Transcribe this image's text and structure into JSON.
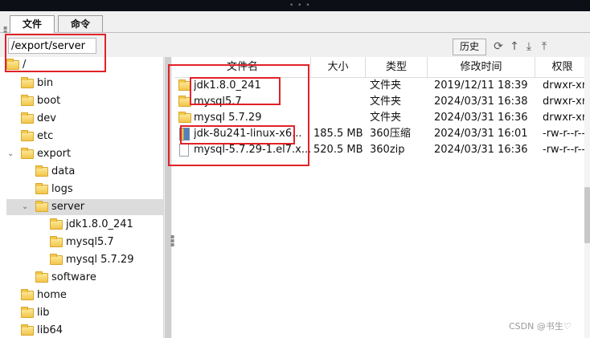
{
  "tabs": [
    {
      "label": "文件"
    },
    {
      "label": "命令"
    }
  ],
  "path": {
    "value": "/export/server"
  },
  "toolbar": {
    "history_label": "历史"
  },
  "tree": [
    {
      "label": "/"
    },
    {
      "label": "bin"
    },
    {
      "label": "boot"
    },
    {
      "label": "dev"
    },
    {
      "label": "etc"
    },
    {
      "label": "export"
    },
    {
      "label": "data"
    },
    {
      "label": "logs"
    },
    {
      "label": "server"
    },
    {
      "label": "jdk1.8.0_241"
    },
    {
      "label": "mysql5.7"
    },
    {
      "label": "mysql 5.7.29"
    },
    {
      "label": "software"
    },
    {
      "label": "home"
    },
    {
      "label": "lib"
    },
    {
      "label": "lib64"
    }
  ],
  "columns": [
    "文件名",
    "大小",
    "类型",
    "修改时间",
    "权限"
  ],
  "files": [
    {
      "name": "jdk1.8.0_241",
      "size": "",
      "type": "文件夹",
      "modified": "2019/12/11 18:39",
      "perm": "drwxr-xr-x",
      "icon": "folder-icon"
    },
    {
      "name": "mysql5.7",
      "size": "",
      "type": "文件夹",
      "modified": "2024/03/31 16:38",
      "perm": "drwxr-xr-x",
      "icon": "folder-icon"
    },
    {
      "name": "mysql 5.7.29",
      "size": "",
      "type": "文件夹",
      "modified": "2024/03/31 16:36",
      "perm": "drwxr-xr-x",
      "icon": "folder-icon"
    },
    {
      "name": "jdk-8u241-linux-x6...",
      "size": "185.5 MB",
      "type": "360压缩",
      "modified": "2024/03/31 16:01",
      "perm": "-rw-r--r--",
      "icon": "archive-icon"
    },
    {
      "name": "mysql-5.7.29-1.el7.x...",
      "size": "520.5 MB",
      "type": "360zip",
      "modified": "2024/03/31 16:36",
      "perm": "-rw-r--r--",
      "icon": "file-icon"
    }
  ],
  "icons": {
    "refresh": "refresh-icon",
    "up": "up-arrow-icon",
    "download": "download-icon",
    "upload": "upload-icon"
  },
  "watermark": "CSDN @书生♡",
  "colors": {
    "annotation": "#e0222a",
    "folder": "#f3c64b",
    "selected": "#dcdcdc"
  }
}
